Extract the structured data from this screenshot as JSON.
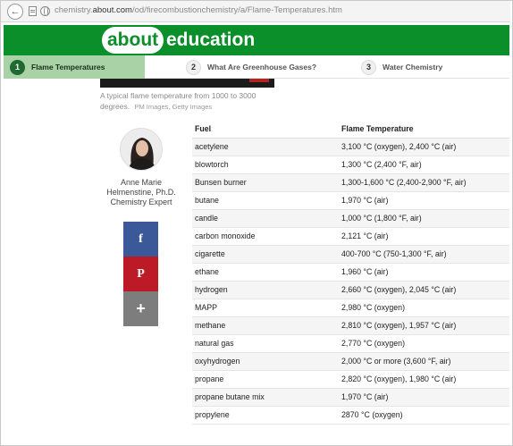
{
  "browser": {
    "url_prefix": "chemistry.",
    "url_host": "about.com",
    "url_path": "/od/firecombustionchemistry/a/Flame-Temperatures.htm"
  },
  "brand": {
    "about": "about",
    "education": "education",
    "color": "#0a8f2a"
  },
  "steps": [
    {
      "num": "1",
      "label": "Flame Temperatures",
      "active": true
    },
    {
      "num": "2",
      "label": "What Are Greenhouse Gases?",
      "active": false
    },
    {
      "num": "3",
      "label": "Water Chemistry",
      "active": false
    }
  ],
  "image": {
    "caption": "A typical flame temperature from 1000 to 3000 degrees.",
    "credit": "PM Images, Getty Images"
  },
  "author": {
    "name": "Anne Marie Helmenstine, Ph.D.",
    "role": "Chemistry Expert"
  },
  "share": {
    "facebook": "f",
    "pinterest": "P",
    "more": "+"
  },
  "table": {
    "headers": [
      "Fuel",
      "Flame Temperature"
    ],
    "rows": [
      [
        "acetylene",
        "3,100 °C (oxygen), 2,400 °C (air)"
      ],
      [
        "blowtorch",
        "1,300 °C (2,400 °F, air)"
      ],
      [
        "Bunsen burner",
        "1,300-1,600 °C (2,400-2,900 °F, air)"
      ],
      [
        "butane",
        "1,970 °C (air)"
      ],
      [
        "candle",
        "1,000 °C (1,800 °F, air)"
      ],
      [
        "carbon monoxide",
        "2,121 °C (air)"
      ],
      [
        "cigarette",
        "400-700 °C (750-1,300 °F, air)"
      ],
      [
        "ethane",
        "1,960 °C (air)"
      ],
      [
        "hydrogen",
        "2,660 °C (oxygen), 2,045 °C (air)"
      ],
      [
        "MAPP",
        "2,980 °C (oxygen)"
      ],
      [
        "methane",
        "2,810 °C (oxygen), 1,957 °C (air)"
      ],
      [
        "natural gas",
        "2,770 °C (oxygen)"
      ],
      [
        "oxyhydrogen",
        "2,000 °C or more (3,600 °F, air)"
      ],
      [
        "propane",
        "2,820 °C (oxygen), 1,980 °C (air)"
      ],
      [
        "propane butane mix",
        "1,970 °C (air)"
      ],
      [
        "propylene",
        "2870 °C (oxygen)"
      ]
    ]
  }
}
